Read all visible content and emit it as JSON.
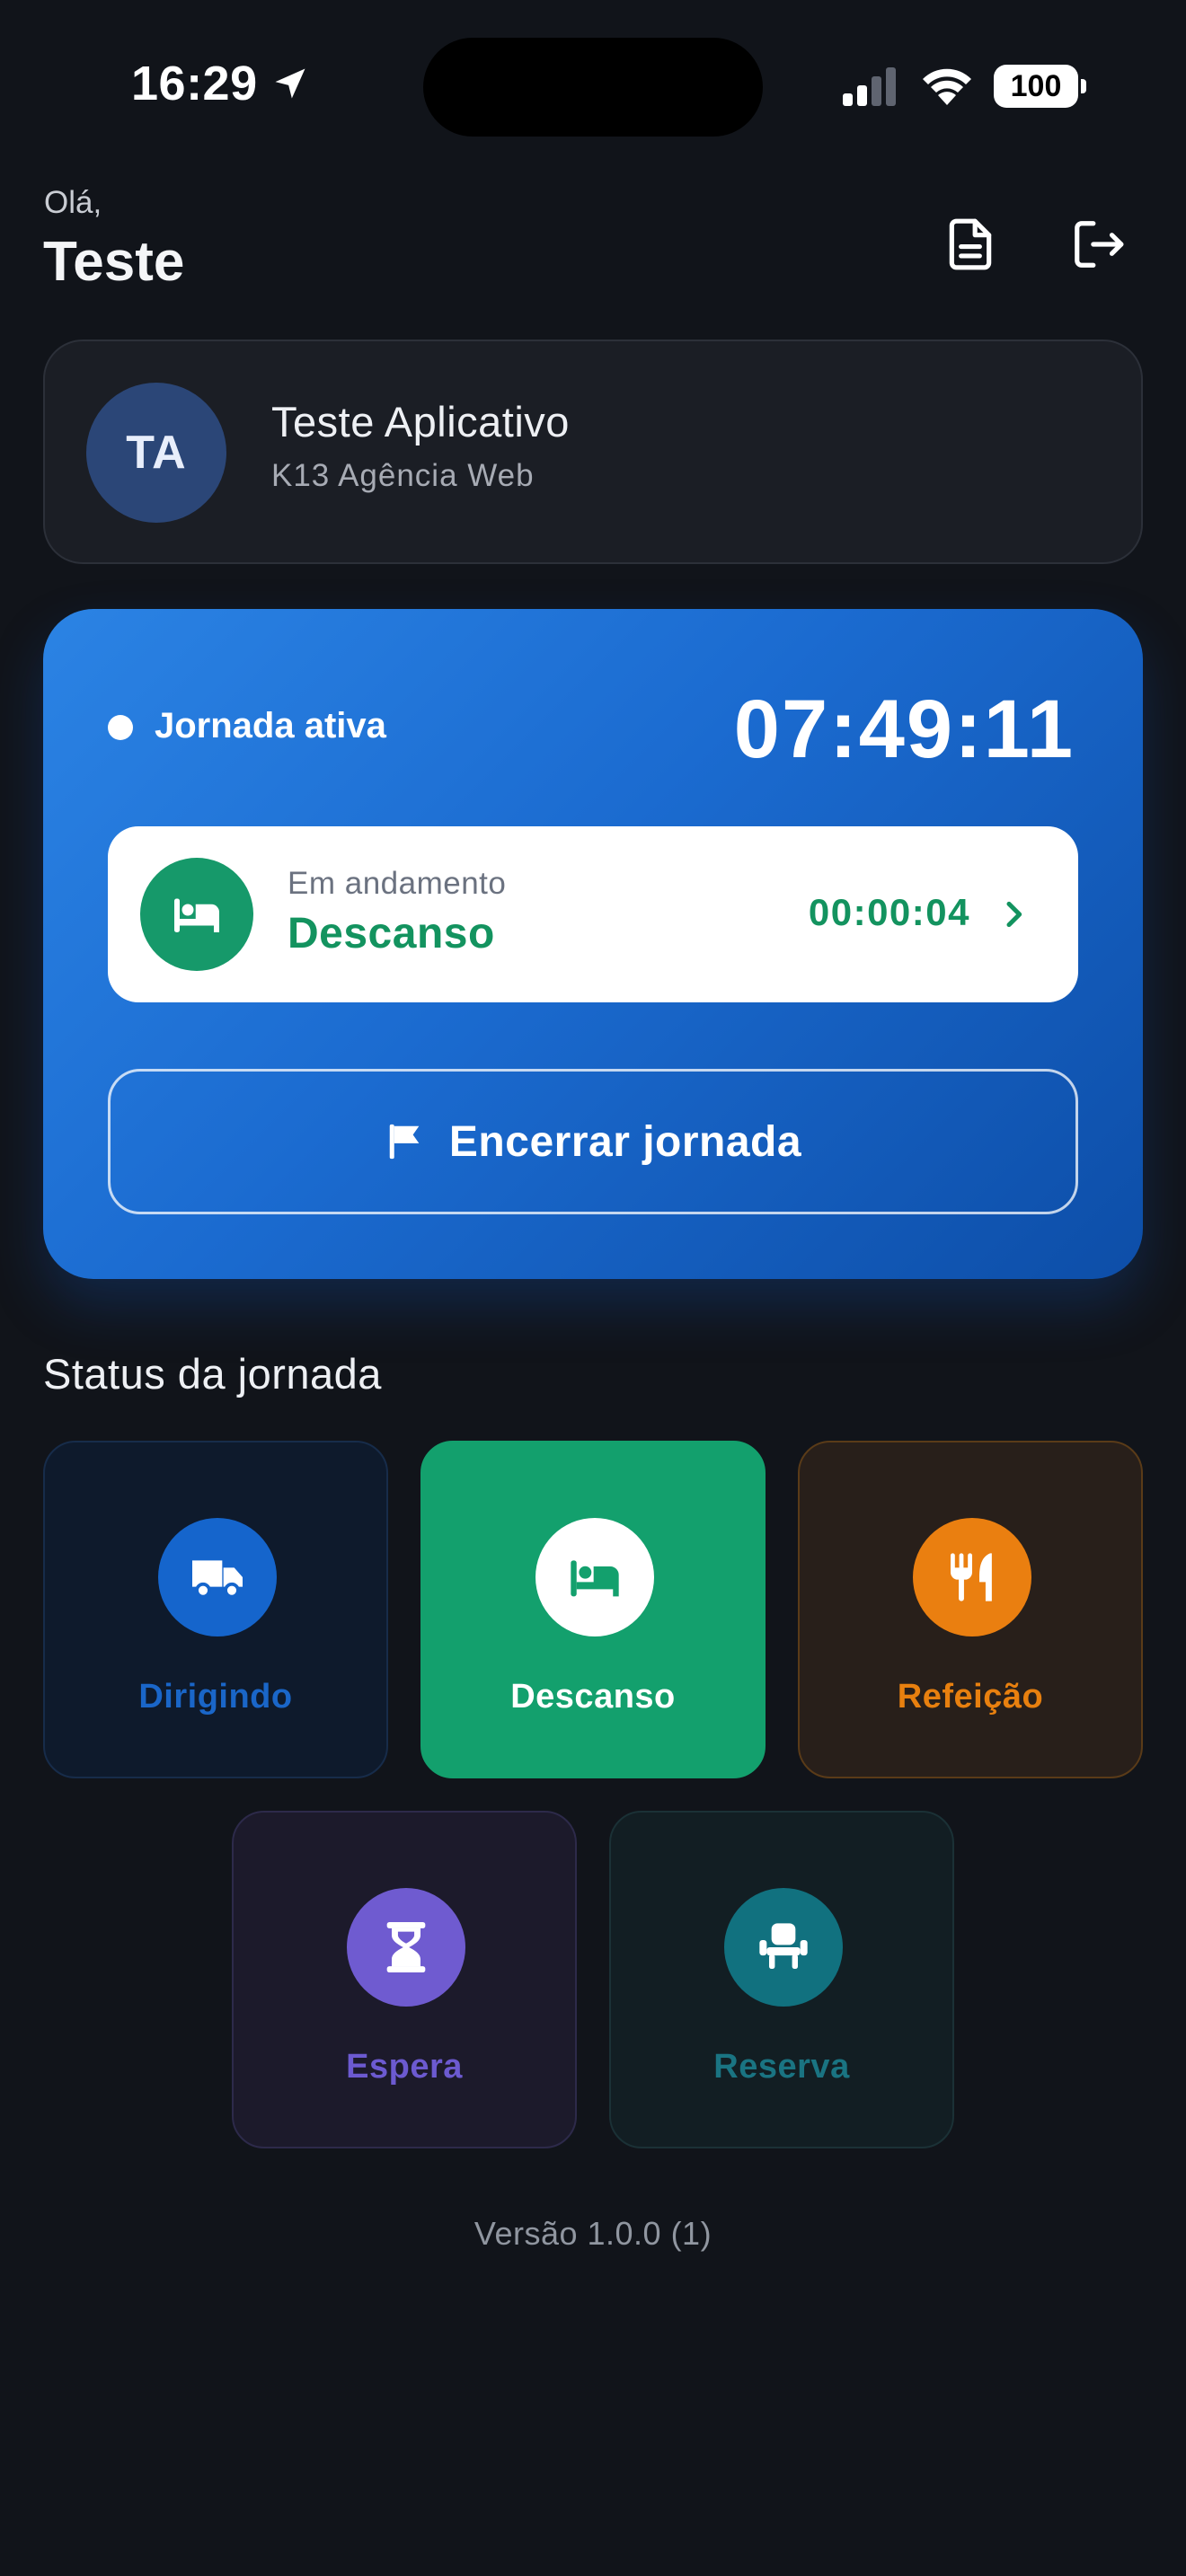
{
  "status_bar": {
    "time": "16:29",
    "battery": "100"
  },
  "header": {
    "greeting": "Olá,",
    "user_first_name": "Teste"
  },
  "profile": {
    "initials": "TA",
    "name": "Teste Aplicativo",
    "company": "K13 Agência Web"
  },
  "journey": {
    "active_label": "Jornada ativa",
    "timer": "07:49:11",
    "current": {
      "caption": "Em andamento",
      "status": "Descanso",
      "timer": "00:00:04"
    },
    "end_button_label": "Encerrar jornada"
  },
  "status_section": {
    "title": "Status da jornada",
    "items": [
      {
        "label": "Dirigindo",
        "icon": "truck-icon"
      },
      {
        "label": "Descanso",
        "icon": "bed-icon",
        "selected": true
      },
      {
        "label": "Refeição",
        "icon": "utensils-icon"
      },
      {
        "label": "Espera",
        "icon": "hourglass-icon"
      },
      {
        "label": "Reserva",
        "icon": "seat-icon"
      }
    ]
  },
  "footer": {
    "version": "Versão 1.0.0 (1)"
  },
  "colors": {
    "background": "#11141a",
    "accent_blue": "#1b6bd0",
    "rest_green": "#13a06d",
    "meal_orange": "#ea7f10",
    "wait_purple": "#6f5bd0",
    "reserve_teal": "#11717f"
  }
}
